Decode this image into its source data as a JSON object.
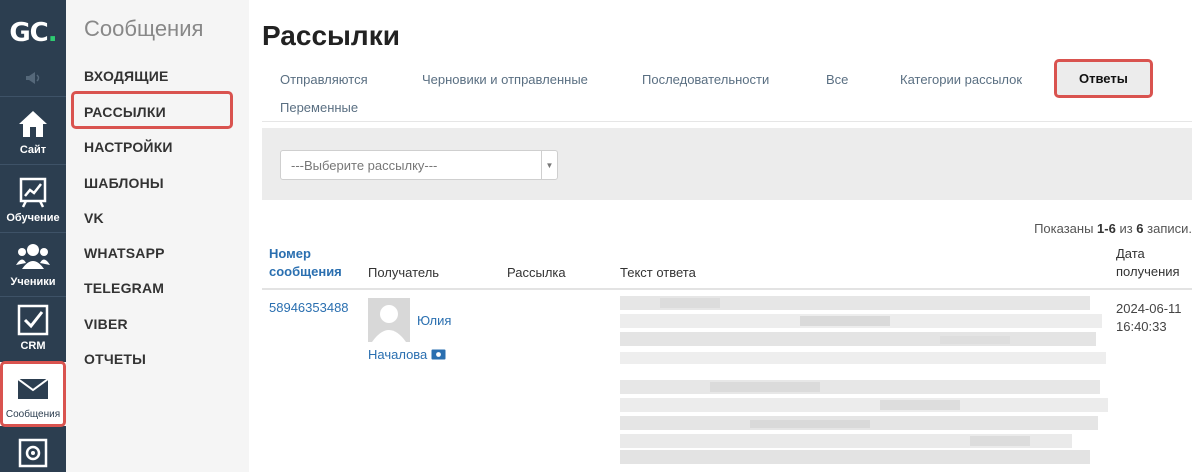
{
  "logo": {
    "letters": "GC",
    "dot": "."
  },
  "rail": {
    "items": [
      {
        "label": "Сайт",
        "icon": "home-icon"
      },
      {
        "label": "Обучение",
        "icon": "chart-icon"
      },
      {
        "label": "Ученики",
        "icon": "users-icon"
      },
      {
        "label": "CRM",
        "icon": "checkbox-icon"
      },
      {
        "label": "Сообщения",
        "icon": "envelope-icon",
        "active": true
      },
      {
        "label": "",
        "icon": "settings-safe-icon"
      }
    ]
  },
  "submenu": {
    "title": "Сообщения",
    "items": [
      "ВХОДЯЩИЕ",
      "РАССЫЛКИ",
      "НАСТРОЙКИ",
      "ШАБЛОНЫ",
      "VK",
      "WHATSAPP",
      "TELEGRAM",
      "VIBER",
      "ОТЧЕТЫ"
    ]
  },
  "page": {
    "title": "Рассылки"
  },
  "tabs": [
    "Отправляются",
    "Черновики и отправленные",
    "Последовательности",
    "Все",
    "Категории рассылок",
    "Ответы",
    "Переменные"
  ],
  "filter": {
    "placeholder": "---Выберите рассылку---"
  },
  "summary": {
    "prefix": "Показаны ",
    "range": "1-6",
    "middle": " из ",
    "total": "6",
    "suffix": " записи."
  },
  "table": {
    "headers": {
      "number_line1": "Номер",
      "number_line2": "сообщения",
      "recipient": "Получатель",
      "mailing": "Рассылка",
      "reply_text": "Текст ответа",
      "date_line1": "Дата",
      "date_line2": "получения"
    },
    "rows": [
      {
        "number": "58946353488",
        "first_name": "Юлия",
        "last_name": "Началова",
        "mailing": "",
        "date": "2024-06-11",
        "time": "16:40:33"
      }
    ]
  },
  "colors": {
    "rail": "#2c3e50",
    "accent_green": "#2ecc71",
    "highlight": "#d9534f",
    "link": "#2a6fb0"
  }
}
